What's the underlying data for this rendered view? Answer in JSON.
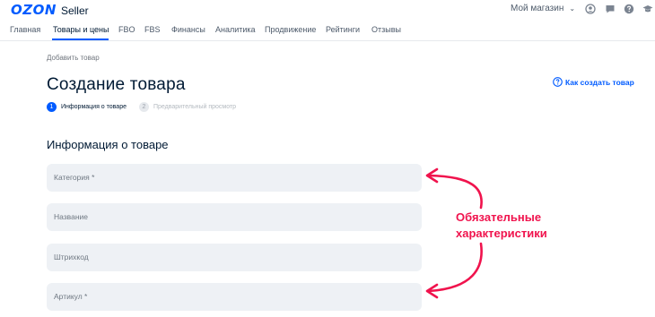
{
  "header": {
    "logo_brand": "OZON",
    "logo_product": "Seller",
    "shop_selector": "Мой магазин",
    "icons": [
      "account-icon",
      "chat-icon",
      "help-icon",
      "graduation-icon"
    ]
  },
  "nav": {
    "items": [
      "Главная",
      "Товары и цены",
      "FBO",
      "FBS",
      "Финансы",
      "Аналитика",
      "Продвижение",
      "Рейтинги",
      "Отзывы"
    ],
    "active": "Товары и цены"
  },
  "breadcrumb": "Добавить товар",
  "page_title": "Создание товара",
  "help_link": "Как создать товар",
  "steps": [
    {
      "number": "1",
      "label": "Информация о товаре",
      "state": "active"
    },
    {
      "number": "2",
      "label": "Предварительный просмотр",
      "state": "inactive"
    }
  ],
  "section_title": "Информация о товаре",
  "fields": [
    {
      "placeholder": "Категория *"
    },
    {
      "placeholder": "Название"
    },
    {
      "placeholder": "Штрихкод"
    },
    {
      "placeholder": "Артикул *"
    }
  ],
  "annotation": {
    "line1": "Обязательные",
    "line2": "характеристики",
    "color": "#f0134d"
  },
  "colors": {
    "accent": "#005bff",
    "field_bg": "#eef1f5",
    "text": "#001a34"
  }
}
